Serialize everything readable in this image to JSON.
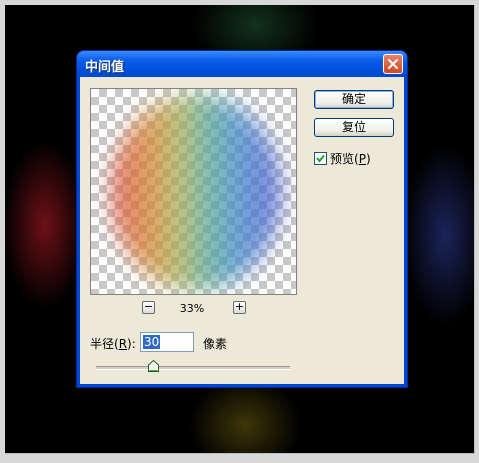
{
  "dialog": {
    "title": "中间值"
  },
  "preview": {
    "zoom": "33%",
    "zoom_out_symbol": "−",
    "zoom_in_symbol": "+"
  },
  "buttons": {
    "ok_label": "确定",
    "reset_label": "复位"
  },
  "preview_toggle": {
    "label_prefix": "预览(",
    "mnemonic": "P",
    "label_suffix": ")",
    "checked": true
  },
  "radius": {
    "label_prefix": "半径(",
    "mnemonic": "R",
    "label_suffix": "):",
    "value": "30",
    "unit": "像素"
  },
  "slider": {
    "value": 30
  }
}
